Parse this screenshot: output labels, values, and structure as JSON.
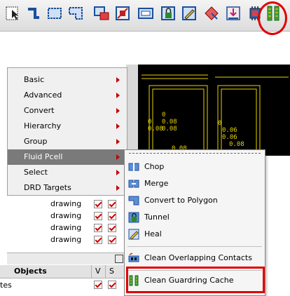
{
  "toolbar": {
    "buttons": [
      {
        "icon": "select-icon"
      },
      {
        "icon": "path-icon"
      },
      {
        "icon": "rectangle-icon"
      },
      {
        "icon": "polygon-icon"
      },
      {
        "icon": "instance-icon"
      },
      {
        "icon": "via-icon"
      },
      {
        "icon": "array-icon"
      },
      {
        "icon": "lock-icon"
      },
      {
        "icon": "edit-icon"
      },
      {
        "icon": "move-icon"
      },
      {
        "icon": "stretch-icon"
      },
      {
        "icon": "chip-icon"
      },
      {
        "icon": "guardring-icon"
      }
    ],
    "highlight_color": "#e00000"
  },
  "menu": {
    "items": [
      {
        "label": "Basic",
        "mnemonic": "B"
      },
      {
        "label": "Advanced",
        "mnemonic": "A"
      },
      {
        "label": "Convert",
        "mnemonic": "n"
      },
      {
        "label": "Hierarchy",
        "mnemonic": "H"
      },
      {
        "label": "Group",
        "mnemonic": "G"
      },
      {
        "label": "Fluid Pcell",
        "mnemonic": "P"
      },
      {
        "label": "Select",
        "mnemonic": "l"
      },
      {
        "label": "DRD Targets",
        "mnemonic": ""
      }
    ],
    "active_index": 5
  },
  "layers": {
    "rows": [
      {
        "name": "drawing"
      },
      {
        "name": "drawing"
      },
      {
        "name": "drawing"
      },
      {
        "name": "drawing"
      }
    ]
  },
  "objects_panel": {
    "header": {
      "objects": "Objects",
      "v": "V",
      "s": "S"
    },
    "row": {
      "name": "tes"
    }
  },
  "submenu": {
    "items": [
      {
        "label": "Chop",
        "icon": "chop-icon"
      },
      {
        "label": "Merge",
        "icon": "merge-icon"
      },
      {
        "label": "Convert to Polygon",
        "icon": "convert-polygon-icon"
      },
      {
        "label": "Tunnel",
        "icon": "tunnel-icon"
      },
      {
        "label": "Heal",
        "icon": "heal-icon"
      },
      {
        "label": "Clean Overlapping Contacts",
        "icon": "clean-contacts-icon"
      },
      {
        "label": "Clean Guardring Cache",
        "icon": "clean-guardring-icon"
      }
    ],
    "highlighted_item": "Clean Guardring Cache"
  },
  "canvas": {
    "background": "#000000",
    "labels": [
      "0",
      "0.08",
      "0.08",
      "0",
      "0.08",
      "0.08",
      "0.06",
      "0.06",
      "0.08",
      "0"
    ]
  }
}
